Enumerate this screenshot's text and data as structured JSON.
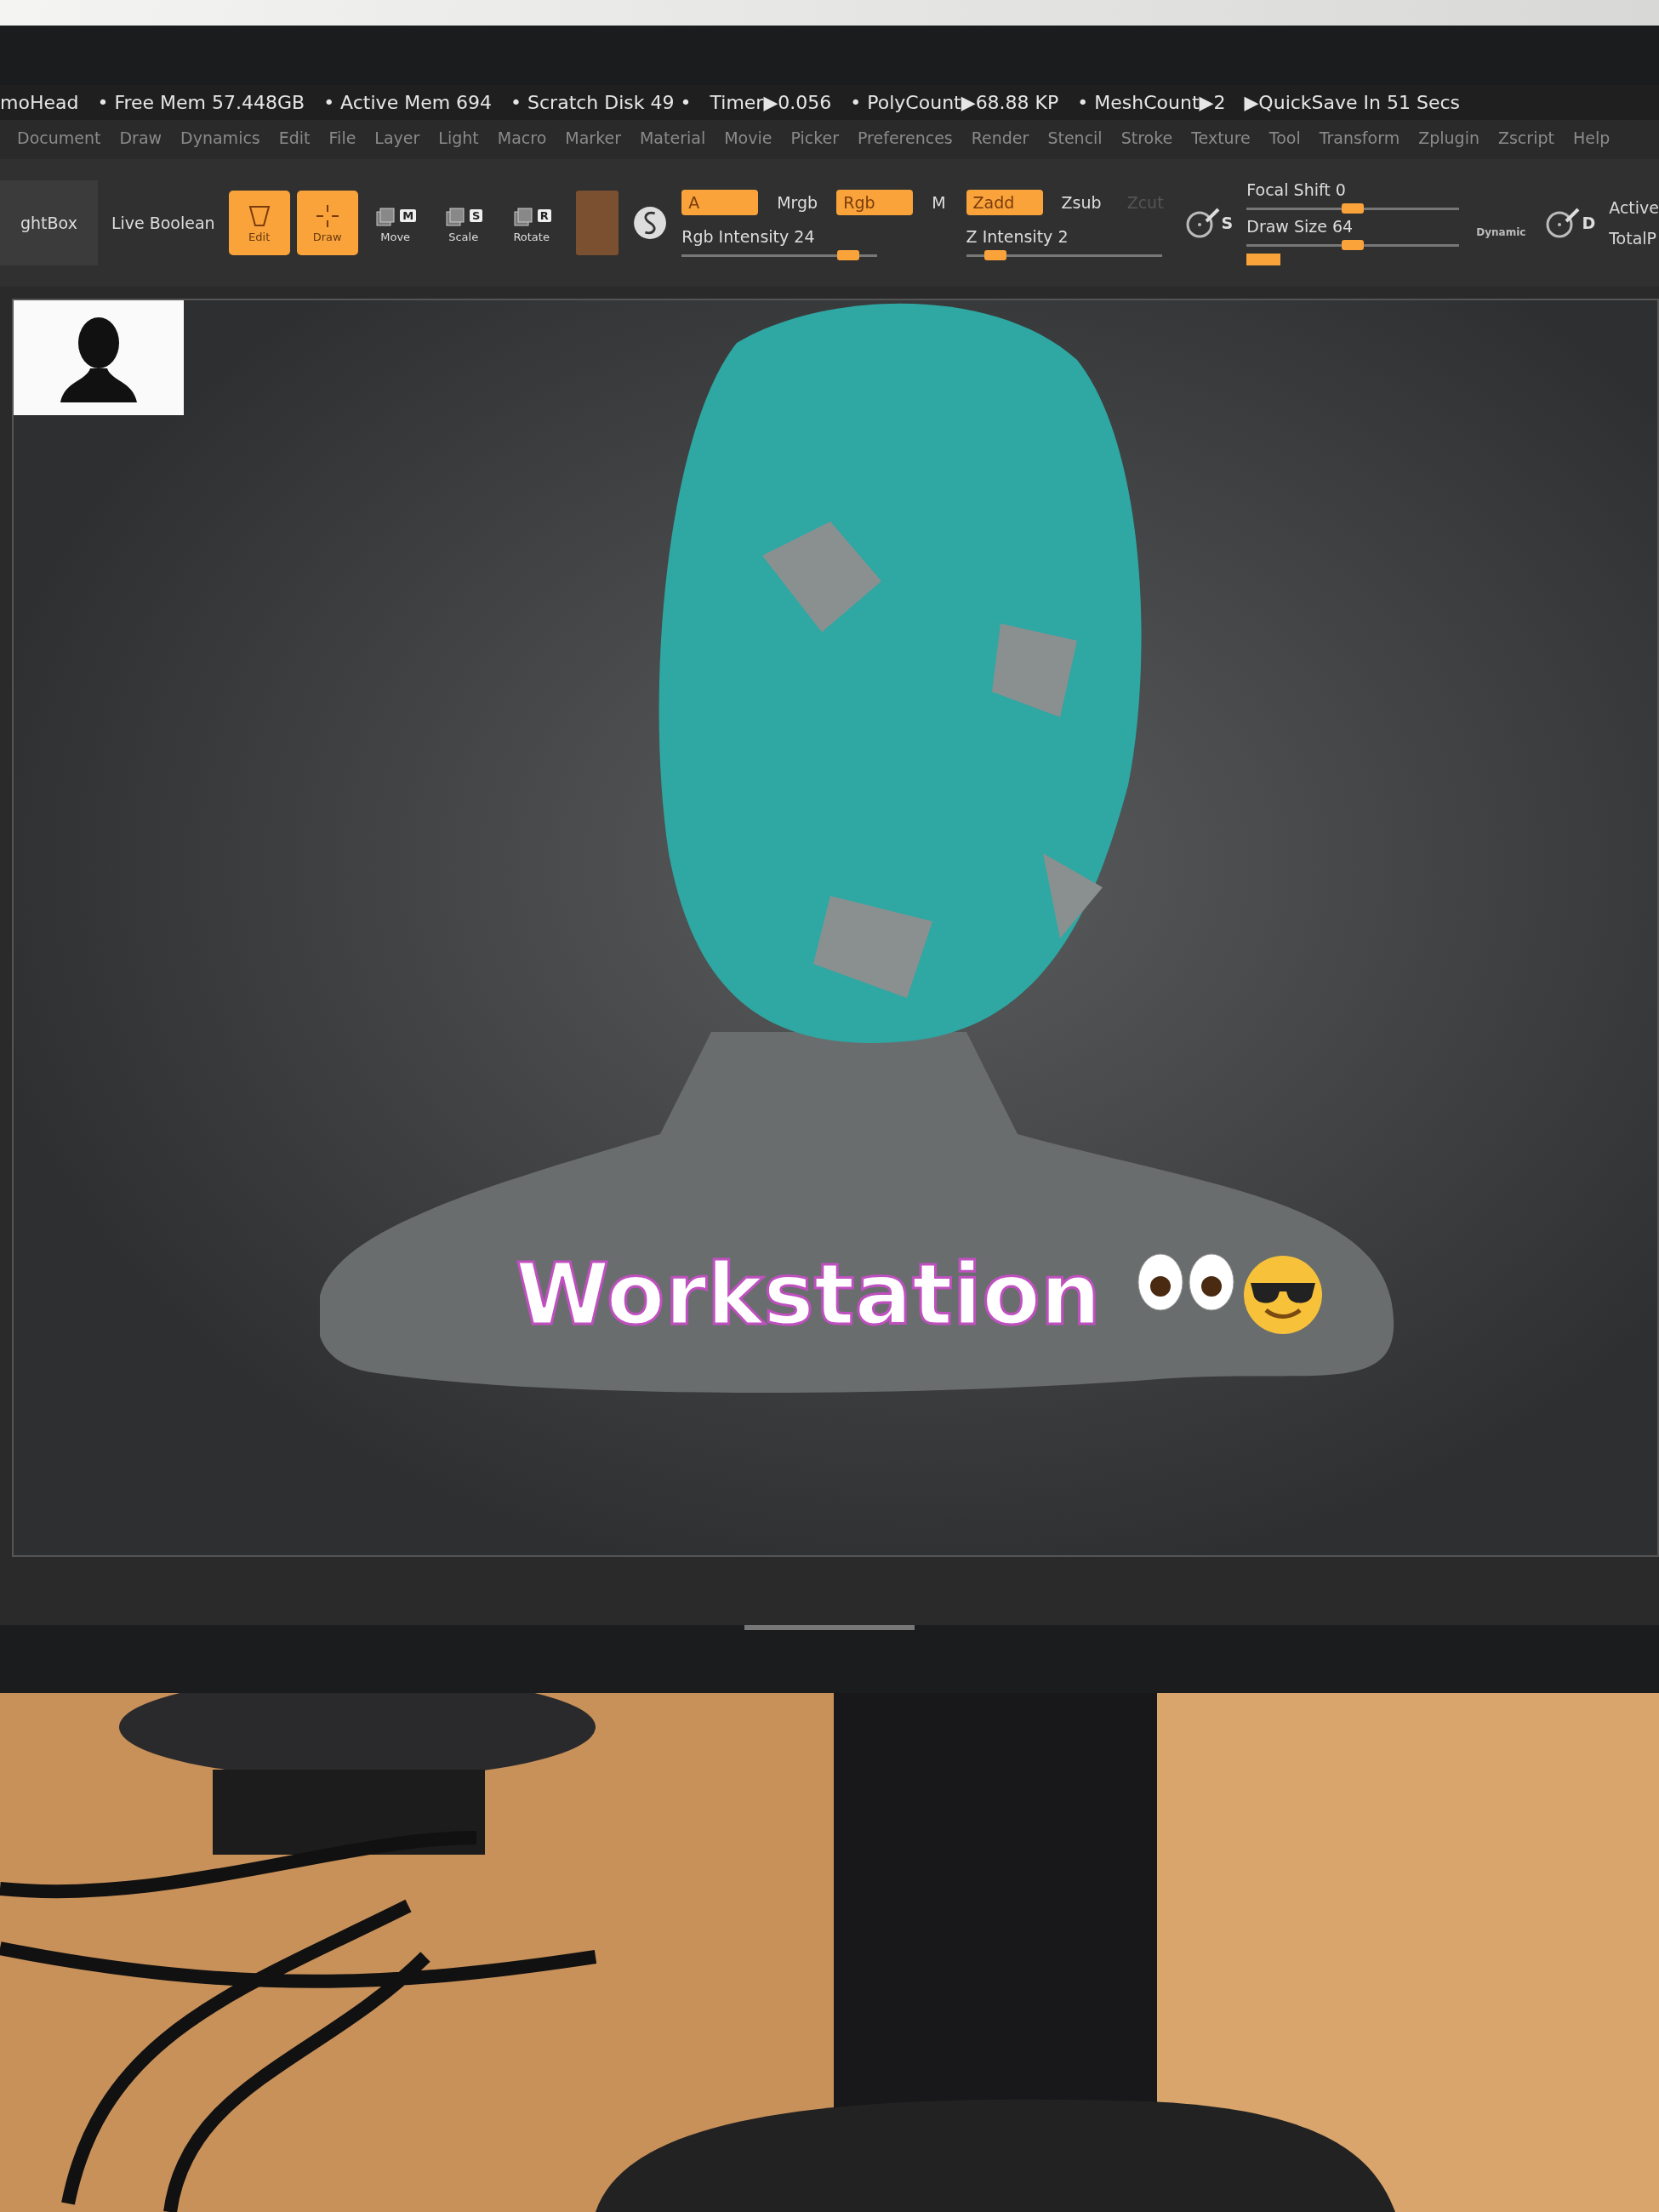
{
  "status_bar": {
    "project": "moHead",
    "items": [
      "• Free Mem 57.448GB",
      "• Active Mem 694",
      "• Scratch Disk 49 •",
      "Timer▶0.056",
      "• PolyCount▶68.88 KP",
      "• MeshCount▶2",
      "▶QuickSave In 51 Secs"
    ]
  },
  "menu": [
    "Document",
    "Draw",
    "Dynamics",
    "Edit",
    "File",
    "Layer",
    "Light",
    "Macro",
    "Marker",
    "Material",
    "Movie",
    "Picker",
    "Preferences",
    "Render",
    "Stencil",
    "Stroke",
    "Texture",
    "Tool",
    "Transform",
    "Zplugin",
    "Zscript",
    "Help"
  ],
  "toolbar": {
    "lightbox": "ghtBox",
    "live_boolean": "Live Boolean",
    "tools": [
      {
        "kind": "edit",
        "label": "Edit",
        "selected": true
      },
      {
        "kind": "draw",
        "label": "Draw",
        "selected": true
      },
      {
        "kind": "move",
        "label": "Move",
        "key": "M",
        "selected": false
      },
      {
        "kind": "scale",
        "label": "Scale",
        "key": "S",
        "selected": false
      },
      {
        "kind": "rotate",
        "label": "Rotate",
        "key": "R",
        "selected": false
      }
    ],
    "channels": [
      {
        "toggles": [
          {
            "label": "A",
            "selected": true,
            "disabled": false
          },
          {
            "label": "Mrgb",
            "selected": false,
            "disabled": false
          },
          {
            "label": "Rgb",
            "selected": true,
            "disabled": false
          },
          {
            "label": "M",
            "selected": false,
            "disabled": false
          }
        ],
        "slider": {
          "label": "Rgb Intensity 24",
          "level": 0.85
        }
      },
      {
        "toggles": [
          {
            "label": "Zadd",
            "selected": true,
            "disabled": false
          },
          {
            "label": "Zsub",
            "selected": false,
            "disabled": false
          },
          {
            "label": "Zcut",
            "selected": false,
            "disabled": true
          }
        ],
        "slider": {
          "label": "Z Intensity 2",
          "level": 0.15
        }
      }
    ],
    "brush_key": "S",
    "sliders": [
      {
        "label": "Focal Shift 0",
        "level": 0.5
      },
      {
        "label": "Draw Size 64",
        "level": 0.5
      }
    ],
    "dynamic": "Dynamic",
    "dynamics_key": "D",
    "right_labels": [
      "Active",
      "TotalP"
    ]
  },
  "caption": "Workstation"
}
